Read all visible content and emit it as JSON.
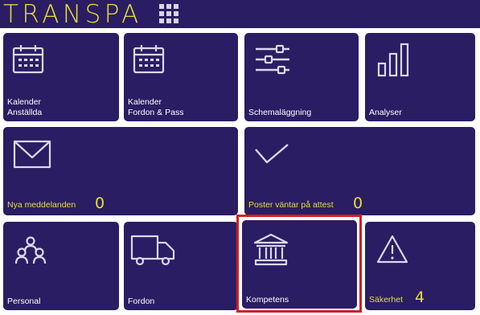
{
  "header": {
    "logo_text": "TRANSPA",
    "apps_icon": "grid-apps-icon",
    "bg_color": "#2a1d63",
    "logo_color": "#e8df3a"
  },
  "tiles": [
    {
      "id": "kalender-anstallda",
      "line1": "Kalender",
      "line2": "Anställda",
      "icon": "calendar-icon"
    },
    {
      "id": "kalender-fordon",
      "line1": "Kalender",
      "line2": "Fordon & Pass",
      "icon": "calendar-icon"
    },
    {
      "id": "schemalaggning",
      "line1": "Schemaläggning",
      "icon": "sliders-icon"
    },
    {
      "id": "analyser",
      "line1": "Analyser",
      "icon": "bar-chart-icon"
    },
    {
      "id": "nya-meddelanden",
      "line1": "Nya meddelanden",
      "count": "0",
      "icon": "envelope-icon"
    },
    {
      "id": "poster-attest",
      "line1": "Poster väntar på attest",
      "count": "0",
      "icon": "checkmark-icon"
    },
    {
      "id": "personal",
      "line1": "Personal",
      "icon": "people-icon"
    },
    {
      "id": "fordon",
      "line1": "Fordon",
      "icon": "truck-icon"
    },
    {
      "id": "kompetens",
      "line1": "Kompetens",
      "icon": "institution-icon",
      "highlighted": true
    },
    {
      "id": "sakerhet",
      "line1": "Säkerhet",
      "count": "4",
      "icon": "warning-triangle-icon"
    }
  ],
  "colors": {
    "tile_bg": "#2a1d63",
    "accent_yellow": "#e8df3a",
    "highlight_red": "#d11f1f"
  }
}
